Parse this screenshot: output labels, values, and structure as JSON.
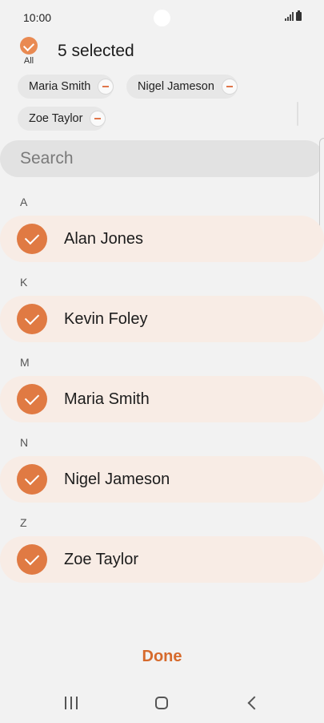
{
  "status_bar": {
    "time": "10:00",
    "icons": [
      "signal-icon",
      "battery-icon"
    ]
  },
  "header": {
    "all_label": "All",
    "selected_count": "5 selected"
  },
  "chips": [
    {
      "label": "Maria Smith"
    },
    {
      "label": "Nigel Jameson"
    },
    {
      "label": "Zoe Taylor"
    }
  ],
  "search": {
    "placeholder": "Search"
  },
  "sections": [
    {
      "letter": "A",
      "contacts": [
        {
          "name": "Alan Jones",
          "selected": true
        }
      ]
    },
    {
      "letter": "K",
      "contacts": [
        {
          "name": "Kevin Foley",
          "selected": true
        }
      ]
    },
    {
      "letter": "M",
      "contacts": [
        {
          "name": "Maria Smith",
          "selected": true
        }
      ]
    },
    {
      "letter": "N",
      "contacts": [
        {
          "name": "Nigel Jameson",
          "selected": true
        }
      ]
    },
    {
      "letter": "Z",
      "contacts": [
        {
          "name": "Zoe Taylor",
          "selected": true
        }
      ]
    }
  ],
  "footer": {
    "done_label": "Done"
  },
  "colors": {
    "accent": "#e07a43",
    "selected_row_bg": "#f8ece5",
    "done_text": "#d66a2c"
  },
  "nav_bar": {
    "icons": [
      "recents-icon",
      "home-icon",
      "back-icon"
    ]
  }
}
